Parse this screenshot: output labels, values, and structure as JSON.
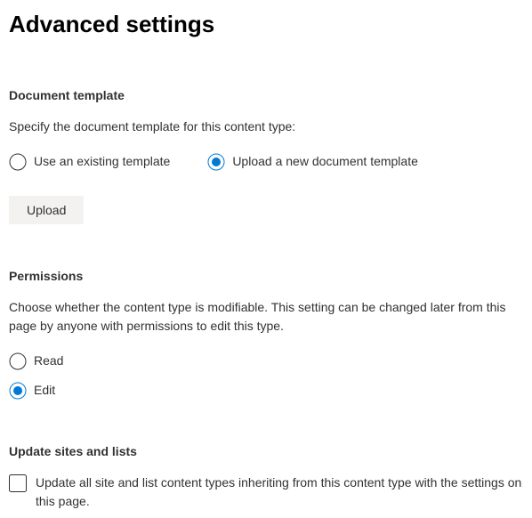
{
  "page": {
    "title": "Advanced settings"
  },
  "template": {
    "heading": "Document template",
    "description": "Specify the document template for this content type:",
    "options": {
      "existing": "Use an existing template",
      "upload": "Upload a new document template"
    },
    "selected": "upload",
    "upload_button": "Upload"
  },
  "permissions": {
    "heading": "Permissions",
    "description": "Choose whether the content type is modifiable. This setting can be changed later from this page by anyone with permissions to edit this type.",
    "options": {
      "read": "Read",
      "edit": "Edit"
    },
    "selected": "edit"
  },
  "update": {
    "heading": "Update sites and lists",
    "checkbox_label": "Update all site and list content types inheriting from this content type with the settings on this page.",
    "checked": false
  },
  "colors": {
    "accent": "#0078d4",
    "border": "#323130"
  }
}
